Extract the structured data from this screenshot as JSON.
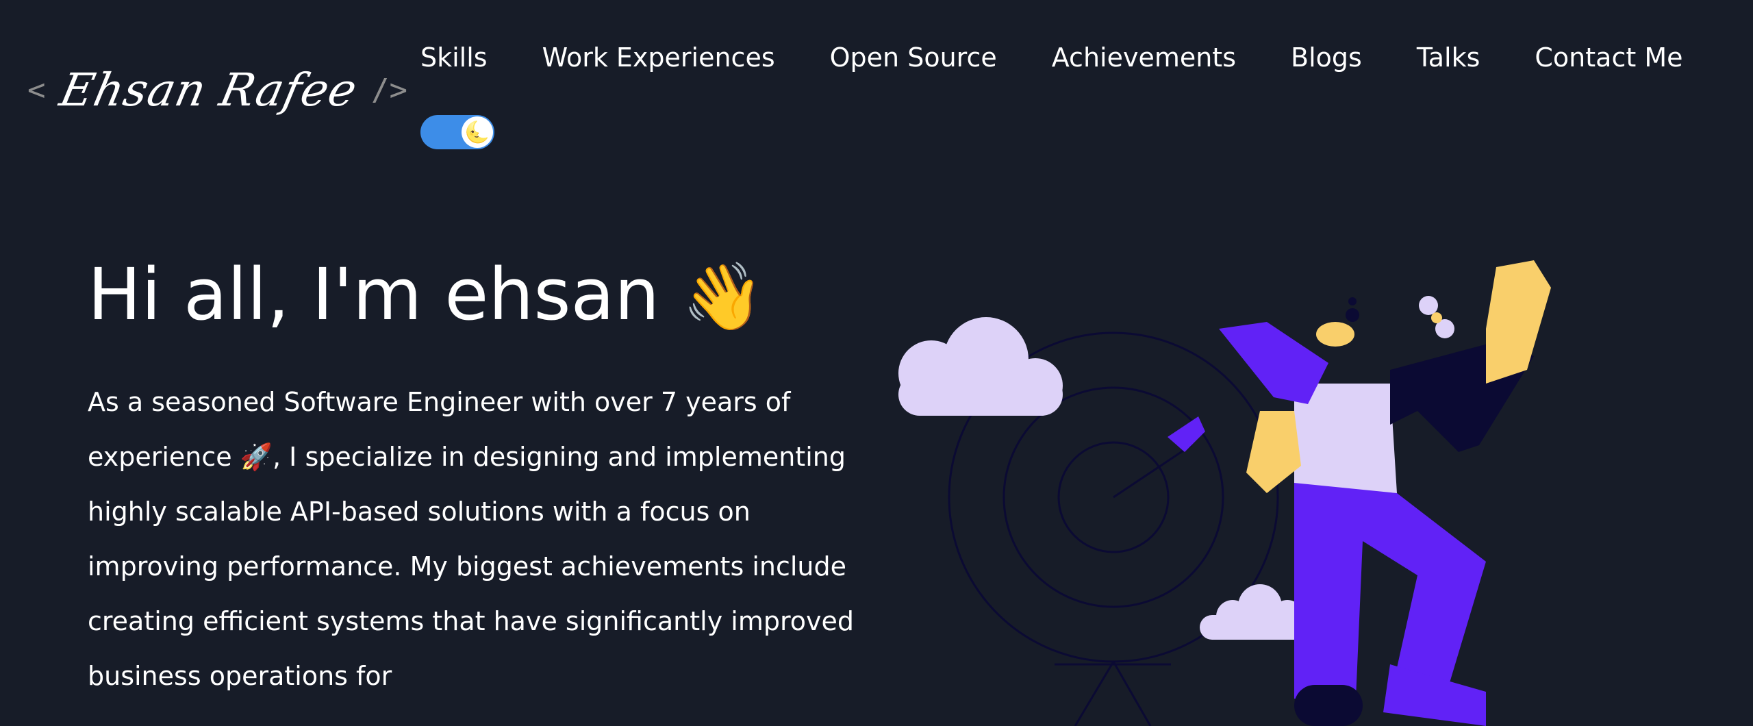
{
  "logo": {
    "open": "<",
    "name": "Ehsan Rafee",
    "close": "/>"
  },
  "nav": {
    "items": [
      "Skills",
      "Work Experiences",
      "Open Source",
      "Achievements",
      "Blogs",
      "Talks",
      "Contact Me"
    ]
  },
  "theme_toggle": {
    "knob_icon": "🌜",
    "state": "dark",
    "accent": "#3d8de8"
  },
  "hero": {
    "greeting": "Hi all, I'm ehsan",
    "wave_emoji": "👋",
    "intro": "As a seasoned Software Engineer with over 7 years of experience 🚀, I specialize in designing and implementing highly scalable API-based solutions with a focus on improving performance. My biggest achievements include creating efficient systems that have significantly improved business operations for"
  },
  "colors": {
    "background": "#171c28",
    "text": "#ffffff",
    "illustration_primary": "#6122f6",
    "illustration_skin": "#f9cf6b",
    "illustration_cloud": "#ddd2f8",
    "illustration_lines": "#0b0a33"
  }
}
